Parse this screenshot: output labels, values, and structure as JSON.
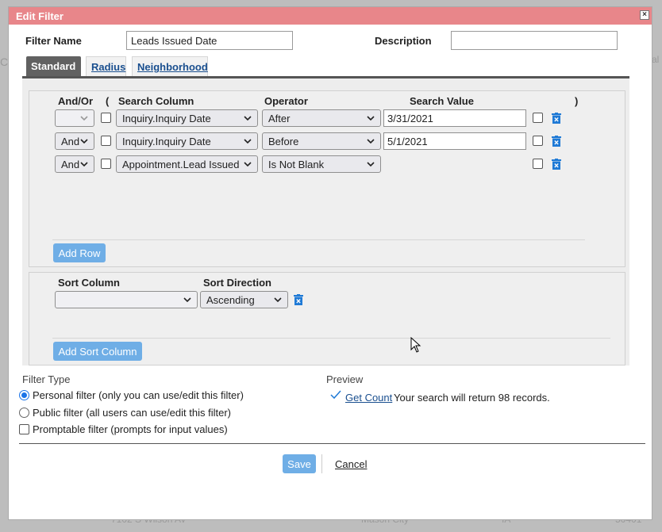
{
  "background": {
    "left_char": "C",
    "right_text": "al",
    "row": [
      "7102 S Wilson Av",
      "Mason City",
      "IA",
      "50401"
    ]
  },
  "dialog": {
    "title": "Edit Filter",
    "close_glyph": "×"
  },
  "fields": {
    "filter_name_label": "Filter Name",
    "filter_name_value": "Leads Issued Date",
    "description_label": "Description",
    "description_value": ""
  },
  "tabs": [
    {
      "label": "Standard",
      "active": true
    },
    {
      "label": "Radius",
      "active": false
    },
    {
      "label": "Neighborhood",
      "active": false
    }
  ],
  "criteria": {
    "headers": {
      "and_or": "And/Or",
      "open_paren": "(",
      "search_column": "Search Column",
      "operator": "Operator",
      "search_value": "Search Value",
      "close_paren": ")"
    },
    "rows": [
      {
        "and_or": "",
        "column": "Inquiry.Inquiry Date",
        "operator": "After",
        "value": "3/31/2021"
      },
      {
        "and_or": "And",
        "column": "Inquiry.Inquiry Date",
        "operator": "Before",
        "value": "5/1/2021"
      },
      {
        "and_or": "And",
        "column": "Appointment.Lead Issued",
        "operator": "Is Not Blank",
        "value": ""
      }
    ],
    "add_row_label": "Add Row"
  },
  "sort": {
    "column_header": "Sort Column",
    "direction_header": "Sort Direction",
    "column_value": "",
    "direction_value": "Ascending",
    "add_label": "Add Sort Column"
  },
  "filter_type": {
    "title": "Filter Type",
    "personal": "Personal filter (only you can use/edit this filter)",
    "public": "Public filter (all users can use/edit this filter)",
    "promptable": "Promptable filter (prompts for input values)"
  },
  "preview": {
    "title": "Preview",
    "get_count_label": "Get Count",
    "result_text": "Your search will return 98 records."
  },
  "footer": {
    "save_label": "Save",
    "cancel_label": "Cancel"
  },
  "colors": {
    "titlebar": "#e8868a",
    "accent_blue": "#6faee6",
    "link": "#1a4f8f",
    "radio": "#1a73e8"
  }
}
